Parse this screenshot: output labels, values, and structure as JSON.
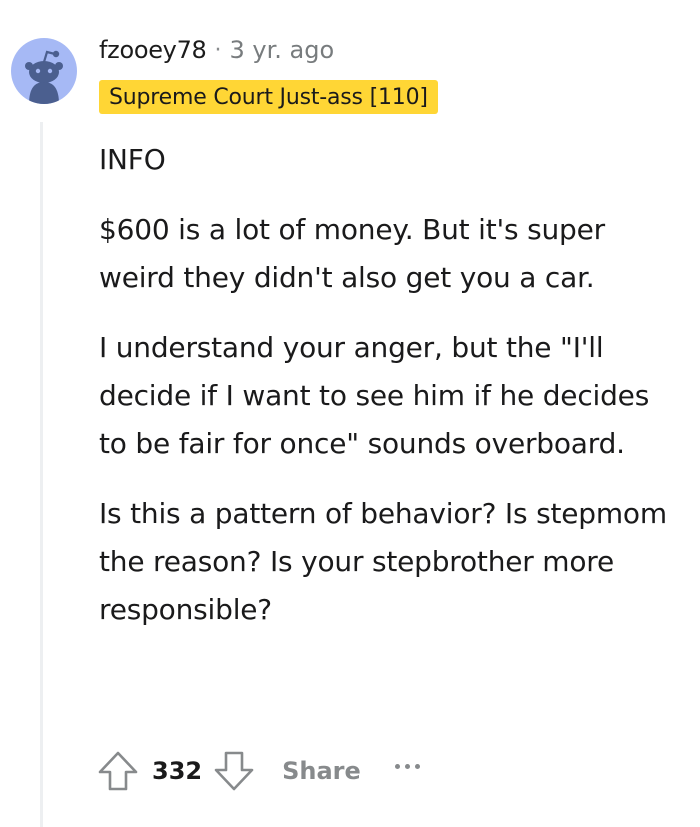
{
  "comment": {
    "username": "fzooey78",
    "separator": "·",
    "timestamp": "3 yr. ago",
    "flair": "Supreme Court Just-ass [110]",
    "paragraphs": [
      "INFO",
      "$600 is a lot of money. But it's super weird they didn't also get you a car.",
      "I understand your anger, but the \"I'll decide if I want to see him if he decides to be fair for once\" sounds overboard.",
      "Is this a pattern of behavior? Is stepmom the reason? Is your stepbrother more responsible?"
    ]
  },
  "actions": {
    "upvote_icon": "upvote-arrow-icon",
    "score": "332",
    "downvote_icon": "downvote-arrow-icon",
    "share_label": "Share",
    "more_icon": "more-options-icon"
  },
  "colors": {
    "flair_bg": "#ffd635",
    "avatar_bg": "#a6b9f5",
    "avatar_figure": "#4b5f8f",
    "muted_text": "#878a8c",
    "thread_line": "#edeff1"
  }
}
